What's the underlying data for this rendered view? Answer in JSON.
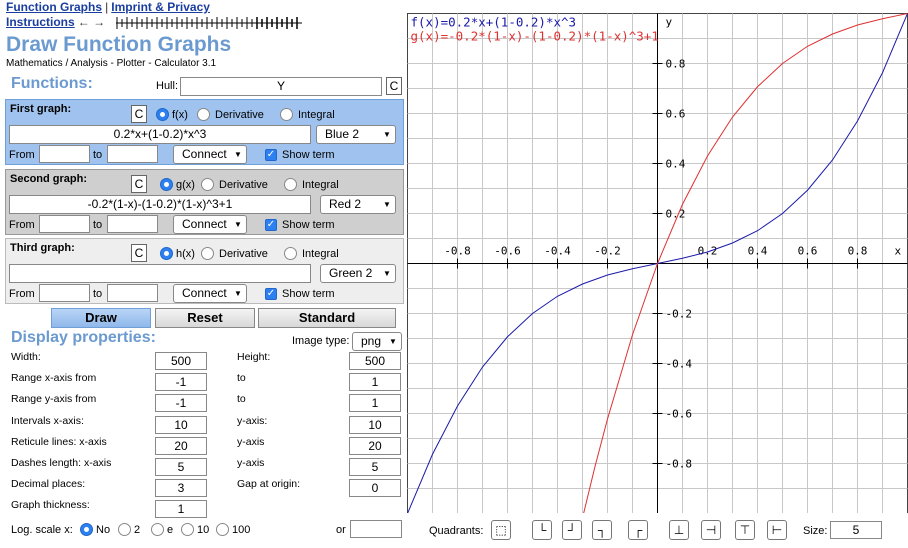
{
  "nav": {
    "function_graphs": "Function Graphs",
    "separator": "|",
    "imprint": "Imprint & Privacy",
    "instructions": "Instructions",
    "arrows": "← →"
  },
  "header": {
    "title": "Draw Function Graphs",
    "subtitle": "Mathematics / Analysis - Plotter - Calculator 3.1"
  },
  "functions": {
    "heading": "Functions:",
    "hull_label": "Hull:",
    "hull_value": "Y",
    "clear": "C"
  },
  "graphs": [
    {
      "label": "First graph:",
      "clear": "C",
      "opt_fx": "f(x)",
      "opt_derivative": "Derivative",
      "opt_integral": "Integral",
      "term": "0.2*x+(1-0.2)*x^3",
      "color": "Blue 2",
      "from_label": "From",
      "to_label": "to",
      "from_value": "",
      "to_value": "",
      "style": "Connect",
      "show_term": "Show term"
    },
    {
      "label": "Second graph:",
      "clear": "C",
      "opt_fx": "g(x)",
      "opt_derivative": "Derivative",
      "opt_integral": "Integral",
      "term": "-0.2*(1-x)-(1-0.2)*(1-x)^3+1",
      "color": "Red 2",
      "from_label": "From",
      "to_label": "to",
      "from_value": "",
      "to_value": "",
      "style": "Connect",
      "show_term": "Show term"
    },
    {
      "label": "Third graph:",
      "clear": "C",
      "opt_fx": "h(x)",
      "opt_derivative": "Derivative",
      "opt_integral": "Integral",
      "term": "",
      "color": "Green 2",
      "from_label": "From",
      "to_label": "to",
      "from_value": "",
      "to_value": "",
      "style": "Connect",
      "show_term": "Show term"
    }
  ],
  "actions": {
    "draw": "Draw",
    "reset": "Reset",
    "standard": "Standard"
  },
  "display": {
    "heading": "Display properties:",
    "image_type_label": "Image type:",
    "image_type": "png",
    "width_label": "Width:",
    "width": "500",
    "height_label": "Height:",
    "height": "500",
    "rx_label": "Range x-axis from",
    "rx_from": "-1",
    "rx_to_label": "to",
    "rx_to": "1",
    "ry_label": "Range y-axis from",
    "ry_from": "-1",
    "ry_to_label": "to",
    "ry_to": "1",
    "ix_label": "Intervals x-axis:",
    "ix": "10",
    "iy_label": "y-axis:",
    "iy": "10",
    "rlx_label": "Reticule lines: x-axis",
    "rlx": "20",
    "rly_label": "y-axis",
    "rly": "20",
    "dlx_label": "Dashes length: x-axis",
    "dlx": "5",
    "dly_label": "y-axis",
    "dly": "5",
    "dp_label": "Decimal places:",
    "dp": "3",
    "gap_label": "Gap at origin:",
    "gap": "0",
    "gt_label": "Graph thickness:",
    "gt": "1",
    "log_label": "Log. scale x:",
    "log_opts": [
      "No",
      "2",
      "e",
      "10",
      "100"
    ],
    "or_label": "or",
    "or_value": ""
  },
  "quadrants": {
    "label": "Quadrants:",
    "buttons": [
      "⬚",
      "└",
      "┘",
      "┐",
      "┌",
      "⊥",
      "⊣",
      "⊤",
      "⊢"
    ],
    "size_label": "Size:",
    "size": "5"
  },
  "colors": {
    "blue": "#1a1aaa",
    "red": "#e03030",
    "title": "#6b9ad0",
    "link": "#1a3ea0"
  },
  "chart_data": {
    "type": "line",
    "xlim": [
      -1,
      1
    ],
    "ylim": [
      -1,
      1
    ],
    "x_ticks": [
      "-0.8",
      "-0.6",
      "-0.4",
      "-0.2",
      "0.2",
      "0.4",
      "0.6",
      "0.8"
    ],
    "y_ticks": [
      "0.8",
      "0.6",
      "0.4",
      "0.2",
      "-0.2",
      "-0.4",
      "-0.6",
      "-0.8"
    ],
    "x_tick_values": [
      -0.8,
      -0.6,
      -0.4,
      -0.2,
      0.2,
      0.4,
      0.6,
      0.8
    ],
    "y_tick_values": [
      0.8,
      0.6,
      0.4,
      0.2,
      -0.2,
      -0.4,
      -0.6,
      -0.8
    ],
    "xlabel": "x",
    "ylabel": "y",
    "grid": true,
    "series": [
      {
        "name": "f(x)=0.2*x+(1-0.2)*x^3",
        "color": "#1a1aaa",
        "x": [
          -1,
          -0.9,
          -0.8,
          -0.7,
          -0.6,
          -0.5,
          -0.4,
          -0.3,
          -0.2,
          -0.1,
          0,
          0.1,
          0.2,
          0.3,
          0.4,
          0.5,
          0.6,
          0.7,
          0.8,
          0.9,
          1
        ],
        "y": [
          -1,
          -0.763,
          -0.57,
          -0.414,
          -0.293,
          -0.2,
          -0.131,
          -0.082,
          -0.046,
          -0.021,
          0,
          0.021,
          0.046,
          0.082,
          0.131,
          0.2,
          0.293,
          0.414,
          0.57,
          0.763,
          1
        ]
      },
      {
        "name": "g(x)=-0.2*(1-x)-(1-0.2)*(1-x)^3+1",
        "color": "#e03030",
        "x": [
          -0.3,
          -0.25,
          -0.2,
          -0.1,
          0,
          0.1,
          0.2,
          0.3,
          0.4,
          0.5,
          0.6,
          0.7,
          0.8,
          0.9,
          1
        ],
        "y": [
          -1.018,
          -0.812,
          -0.622,
          -0.285,
          0,
          0.237,
          0.43,
          0.586,
          0.707,
          0.8,
          0.869,
          0.918,
          0.954,
          0.979,
          1
        ]
      }
    ]
  }
}
